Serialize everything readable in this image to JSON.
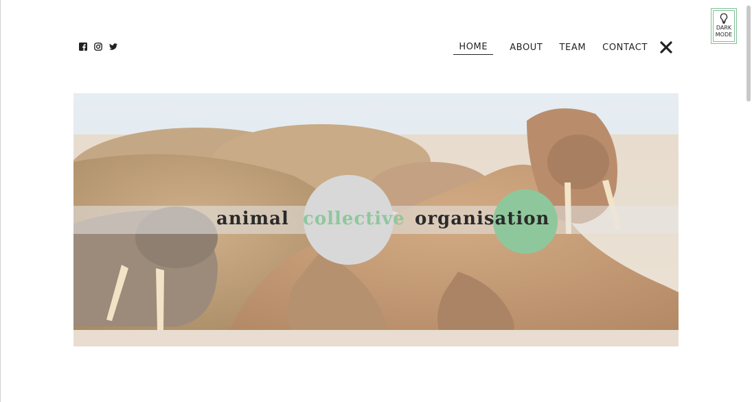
{
  "social": {
    "icons": [
      "facebook-icon",
      "instagram-icon",
      "twitter-icon"
    ]
  },
  "nav": {
    "items": [
      {
        "label": "HOME",
        "active": true
      },
      {
        "label": "ABOUT",
        "active": false
      },
      {
        "label": "TEAM",
        "active": false
      },
      {
        "label": "CONTACT",
        "active": false
      }
    ],
    "close_icon": "close-icon"
  },
  "dark_mode": {
    "line1": "DARK",
    "line2": "MODE",
    "icon": "lightbulb-icon",
    "accent": "#7dbf94"
  },
  "hero": {
    "title_words": [
      "animal",
      "collective",
      "organisation"
    ],
    "accent_green": "#8fc79c",
    "accent_grey": "#d8d8d8"
  }
}
